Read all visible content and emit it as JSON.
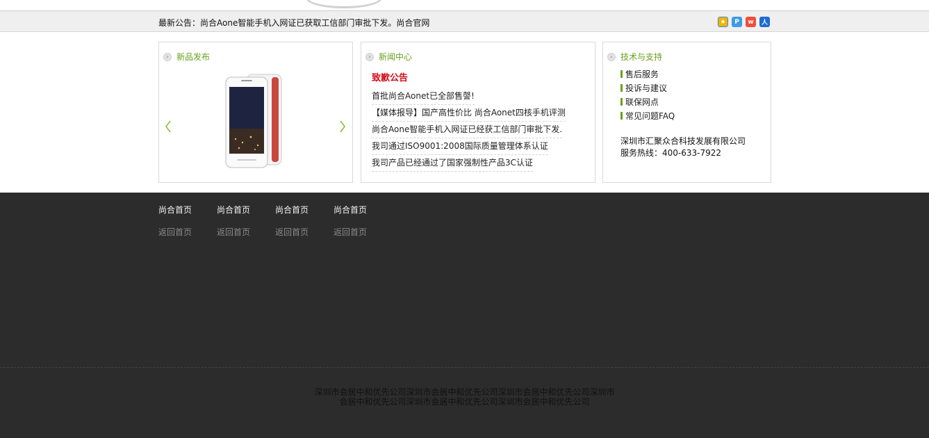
{
  "notice": {
    "text": "最新公告：尚合Aone智能手机入网证已获取工信部门审批下发。尚合官网"
  },
  "share": [
    {
      "icon": "qzone-icon",
      "glyph": "★",
      "color": "#f0b400"
    },
    {
      "icon": "qq-weibo-icon",
      "glyph": "P",
      "color": "#3e9be6"
    },
    {
      "icon": "sina-weibo-icon",
      "glyph": "w",
      "color": "#f24c3c"
    },
    {
      "icon": "renren-icon",
      "glyph": "人",
      "color": "#1c6cd1"
    }
  ],
  "panels": {
    "products": {
      "title": "新品发布"
    },
    "news": {
      "title": "新闻中心",
      "headline": "致歉公告",
      "items": [
        "首批尚合Aonet已全部售謦!",
        "【媒体报导】国产高性价比 尚合Aonet四核手机评测",
        "尚合Aone智能手机入网证已经获工信部门审批下发.",
        "我司通过ISO9001:2008国际质量管理体系认证",
        "我司产品已经通过了国家强制性产品3C认证"
      ]
    },
    "support": {
      "title": "技术与支持",
      "items": [
        "售后服务",
        "投诉与建议",
        "联保网点",
        "常见问题FAQ"
      ],
      "company": "深圳市汇聚众合科技发展有限公司",
      "hotline": "服务热线：400-633-7922"
    }
  },
  "footer": {
    "columns": [
      {
        "main": "尚合首页",
        "sub": "返回首页"
      },
      {
        "main": "尚合首页",
        "sub": "返回首页"
      },
      {
        "main": "尚合首页",
        "sub": "返回首页"
      },
      {
        "main": "尚合首页",
        "sub": "返回首页"
      }
    ],
    "copy_line1": "深圳市会居中和优先公司深圳市会居中和优先公司深圳市会居中和优先公司深圳市",
    "copy_line2": "会居中和优先公司深圳市会居中和优先公司深圳市会居中和优先公司"
  },
  "colors": {
    "accent_green": "#6aa01c",
    "headline_red": "#d30c1a",
    "footer_bg": "#2c2c2c"
  }
}
